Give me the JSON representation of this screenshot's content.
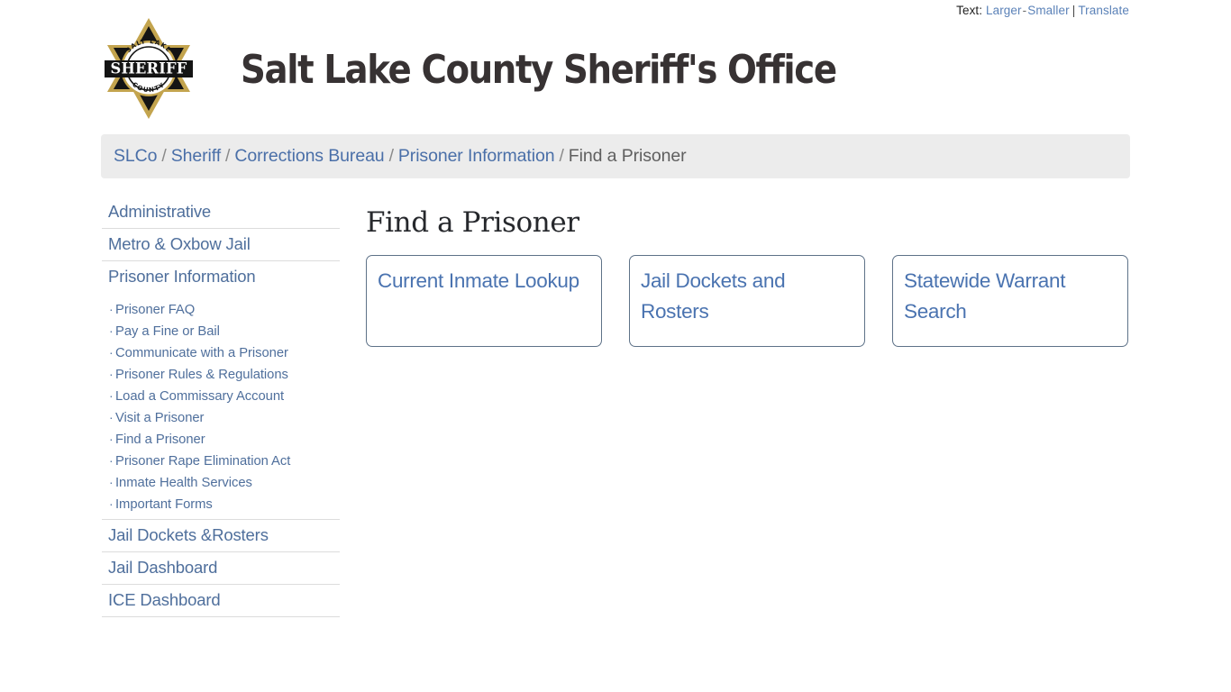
{
  "utility": {
    "label": "Text:",
    "larger": "Larger",
    "separator": "-",
    "smaller": "Smaller",
    "pipe": "|",
    "translate": "Translate"
  },
  "header": {
    "title": "Salt Lake County Sheriff's Office",
    "badge": {
      "top_arc": "SALT LAKE",
      "bottom_arc": "COUNTY",
      "banner": "SHERIFF",
      "gold": "#bfa14a",
      "black": "#111111"
    }
  },
  "breadcrumb": {
    "items": [
      {
        "label": "SLCo",
        "current": false
      },
      {
        "label": "Sheriff",
        "current": false
      },
      {
        "label": "Corrections Bureau",
        "current": false
      },
      {
        "label": "Prisoner Information",
        "current": false
      },
      {
        "label": "Find a Prisoner",
        "current": true
      }
    ],
    "separator": "/"
  },
  "sidebar": {
    "top_items": [
      {
        "label": "Administrative"
      },
      {
        "label": "Metro & Oxbow Jail"
      },
      {
        "label": "Prisoner Information"
      }
    ],
    "sub_items": [
      {
        "label": "Prisoner FAQ"
      },
      {
        "label": "Pay a Fine or Bail"
      },
      {
        "label": "Communicate with a Prisoner"
      },
      {
        "label": "Prisoner Rules & Regulations"
      },
      {
        "label": "Load a Commissary Account"
      },
      {
        "label": "Visit a Prisoner"
      },
      {
        "label": "Find a Prisoner"
      },
      {
        "label": "Prisoner Rape Elimination Act"
      },
      {
        "label": "Inmate Health Services"
      },
      {
        "label": "Important Forms"
      }
    ],
    "bullet": "·",
    "bottom_items": [
      {
        "label": "Jail Dockets &Rosters"
      },
      {
        "label": "Jail Dashboard"
      },
      {
        "label": "ICE Dashboard"
      }
    ]
  },
  "main": {
    "page_title": "Find a Prisoner",
    "cards": [
      {
        "label": "Current Inmate Lookup"
      },
      {
        "label": "Jail Dockets and Rosters"
      },
      {
        "label": "Statewide Warrant Search"
      }
    ]
  },
  "colors": {
    "link_blue": "#4a73b0",
    "sidebar_blue": "#4f6f9c",
    "breadcrumb_bg": "#ececec",
    "title_dark": "#373233",
    "card_border": "#5e7288"
  }
}
